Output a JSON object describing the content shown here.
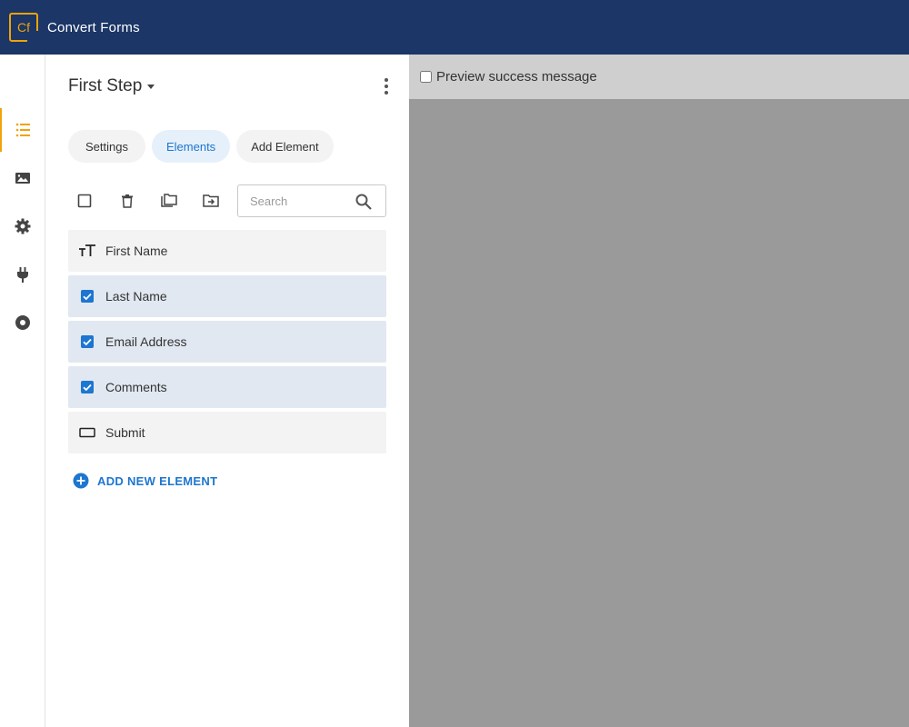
{
  "app": {
    "logo_text": "Cf",
    "title": "Convert Forms"
  },
  "rail": {
    "items": [
      {
        "icon": "list-icon",
        "active": true
      },
      {
        "icon": "image-icon",
        "active": false
      },
      {
        "icon": "gear-icon",
        "active": false
      },
      {
        "icon": "plug-icon",
        "active": false
      },
      {
        "icon": "record-icon",
        "active": false
      }
    ],
    "accent": "#f0a30a"
  },
  "panel": {
    "step_title": "First Step",
    "tabs": [
      {
        "label": "Settings",
        "active": false
      },
      {
        "label": "Elements",
        "active": true
      },
      {
        "label": "Add Element",
        "active": false
      }
    ],
    "search": {
      "placeholder": "Search",
      "value": ""
    },
    "elements": [
      {
        "label": "First Name",
        "icon": "text-icon",
        "selected": false
      },
      {
        "label": "Last Name",
        "icon": "checkbox-checked-icon",
        "selected": true
      },
      {
        "label": "Email Address",
        "icon": "checkbox-checked-icon",
        "selected": true
      },
      {
        "label": "Comments",
        "icon": "checkbox-checked-icon",
        "selected": true
      },
      {
        "label": "Submit",
        "icon": "button-icon",
        "selected": false
      }
    ],
    "add_new_label": "ADD NEW ELEMENT"
  },
  "preview": {
    "checkbox_label": "Preview success message",
    "checked": false
  },
  "colors": {
    "topbar": "#1b3667",
    "accent": "#f0a30a",
    "link": "#1d76cf",
    "preview_bg": "#9a9a9a"
  }
}
